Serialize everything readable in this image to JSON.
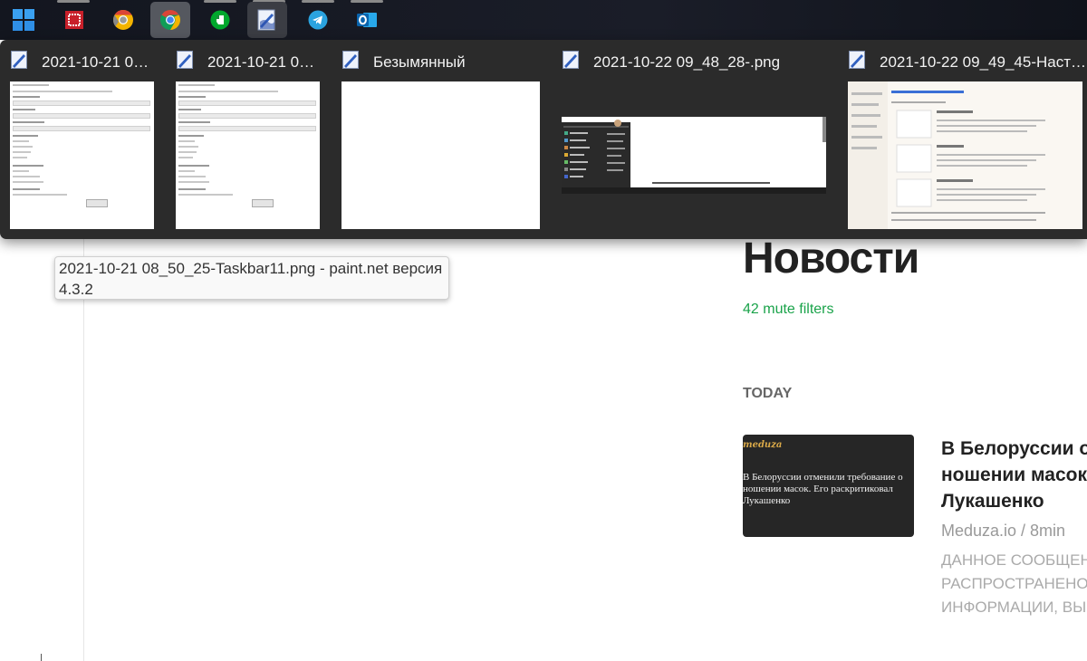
{
  "taskbar": {
    "apps": [
      {
        "name": "start-icon",
        "state": "normal"
      },
      {
        "name": "app-red-icon",
        "state": "normal"
      },
      {
        "name": "chrome-dev-icon",
        "state": "normal"
      },
      {
        "name": "chrome-icon",
        "state": "hover"
      },
      {
        "name": "evernote-icon",
        "state": "normal"
      },
      {
        "name": "paintnet-icon",
        "state": "active"
      },
      {
        "name": "telegram-icon",
        "state": "normal"
      },
      {
        "name": "outlook-icon",
        "state": "normal"
      }
    ]
  },
  "flyout": {
    "windows": [
      {
        "title": "2021-10-21 0…"
      },
      {
        "title": "2021-10-21 0…"
      },
      {
        "title": "Безымянный"
      },
      {
        "title": "2021-10-22 09_48_28-.png"
      },
      {
        "title": "2021-10-22 09_49_45-Наст…"
      }
    ]
  },
  "tooltip": {
    "text": "2021-10-21 08_50_25-Taskbar11.png - paint.net версия 4.3.2"
  },
  "news": {
    "heading": "Новости",
    "mute_link": "42 mute filters",
    "section": "TODAY",
    "article": {
      "thumb_brand": "meduza",
      "thumb_text": "В Белоруссии отменили требование о ношении масок. Его раскритиковал Лукашенко",
      "title_lines": [
        "В Белоруссии отменили требование о",
        "ношении масок",
        "Лукашенко"
      ],
      "source": "Meduza.io / 8min",
      "snippet_lines": [
        "ДАННОЕ СООБЩЕНИЕ (МАТЕРИАЛ) СОЗДАНО И (ИЛИ)",
        "РАСПРОСТРАНЕНО ИНОСТРАННЫМ СРЕДСТВОМ МАССОВОЙ",
        "ИНФОРМАЦИИ, ВЫПОЛНЯЮЩИМ ФУНКЦИИ"
      ]
    }
  },
  "colors": {
    "accent_green": "#1aa34a",
    "flyout_bg": "#2b2b2b",
    "taskbar_bg": "#161a24"
  }
}
